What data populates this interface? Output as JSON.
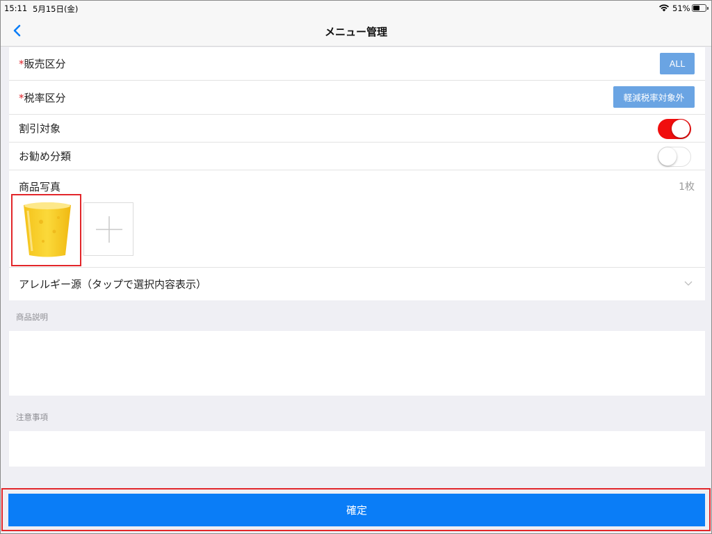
{
  "status_bar": {
    "time": "15:11",
    "date": "5月15日(金)",
    "battery": "51%"
  },
  "nav": {
    "title": "メニュー管理",
    "back_icon": "chevron-left-icon"
  },
  "form": {
    "required_mark": "*",
    "sales_category": {
      "label": "販売区分",
      "value": "ALL"
    },
    "tax_category": {
      "label": "税率区分",
      "value": "軽減税率対象外"
    },
    "discount_target": {
      "label": "割引対象",
      "enabled": true
    },
    "recommended_category": {
      "label": "お勧め分類",
      "enabled": false
    },
    "product_photo": {
      "label": "商品写真",
      "count": "1枚"
    },
    "allergen": {
      "label": "アレルギー源（タップで選択内容表示）"
    }
  },
  "description": {
    "label": "商品説明",
    "value": ""
  },
  "notes": {
    "label": "注意事項",
    "value": ""
  },
  "confirm_button": {
    "label": "確定"
  },
  "colors": {
    "accent_blue": "#0a7df7",
    "pill_blue": "#6aa4e3",
    "toggle_on": "#f00e0e",
    "highlight_red": "#e2262a"
  }
}
